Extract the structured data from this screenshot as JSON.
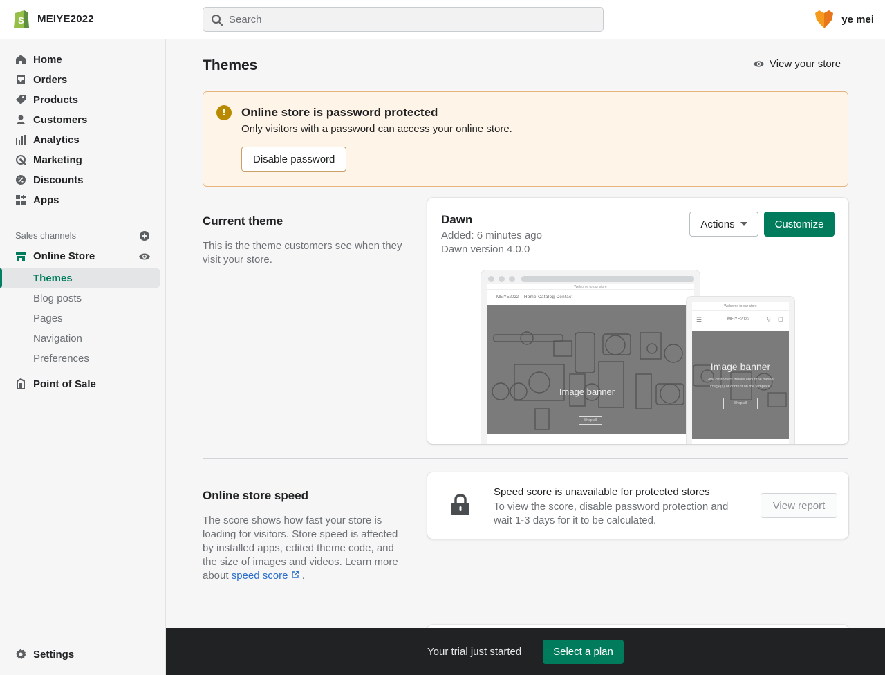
{
  "header": {
    "store_name": "MEIYE2022",
    "search_placeholder": "Search",
    "user_name": "ye mei"
  },
  "sidebar": {
    "items": [
      {
        "label": "Home",
        "icon": "home-icon"
      },
      {
        "label": "Orders",
        "icon": "orders-icon"
      },
      {
        "label": "Products",
        "icon": "tag-icon"
      },
      {
        "label": "Customers",
        "icon": "person-icon"
      },
      {
        "label": "Analytics",
        "icon": "bar-chart-icon"
      },
      {
        "label": "Marketing",
        "icon": "target-icon"
      },
      {
        "label": "Discounts",
        "icon": "discount-icon"
      },
      {
        "label": "Apps",
        "icon": "apps-icon"
      }
    ],
    "sales_channels_label": "Sales channels",
    "online_store": {
      "label": "Online Store",
      "subitems": [
        "Themes",
        "Blog posts",
        "Pages",
        "Navigation",
        "Preferences"
      ],
      "active": "Themes"
    },
    "point_of_sale": "Point of Sale",
    "settings": "Settings"
  },
  "page": {
    "title": "Themes",
    "view_store": "View your store"
  },
  "banner": {
    "title": "Online store is password protected",
    "text": "Only visitors with a password can access your online store.",
    "button": "Disable password"
  },
  "current_theme": {
    "section_title": "Current theme",
    "section_desc": "This is the theme customers see when they visit your store.",
    "name": "Dawn",
    "added": "Added: 6 minutes ago",
    "version": "Dawn version 4.0.0",
    "actions_button": "Actions",
    "customize_button": "Customize",
    "preview": {
      "announcement": "Welcome to our store",
      "brand": "MEIYE2022",
      "links": "Home   Catalog   Contact",
      "hero_title": "Image banner",
      "hero_button": "Shop all",
      "mobile_hero_text": "Give customers details about the banner image(s) or content on the template."
    }
  },
  "speed": {
    "section_title": "Online store speed",
    "section_desc": "The score shows how fast your store is loading for visitors. Store speed is affected by installed apps, edited theme code, and the size of images and videos. Learn more about",
    "link": "speed score",
    "period": " .",
    "card_title": "Speed score is unavailable for protected stores",
    "card_text": "To view the score, disable password protection and wait 1-3 days for it to be calculated.",
    "report_button": "View report"
  },
  "trial": {
    "text": "Your trial just started",
    "button": "Select a plan"
  },
  "colors": {
    "accent": "#007b5c",
    "banner_bg": "#fff4e8",
    "warning": "#b98900",
    "trial_bar": "#202223"
  }
}
